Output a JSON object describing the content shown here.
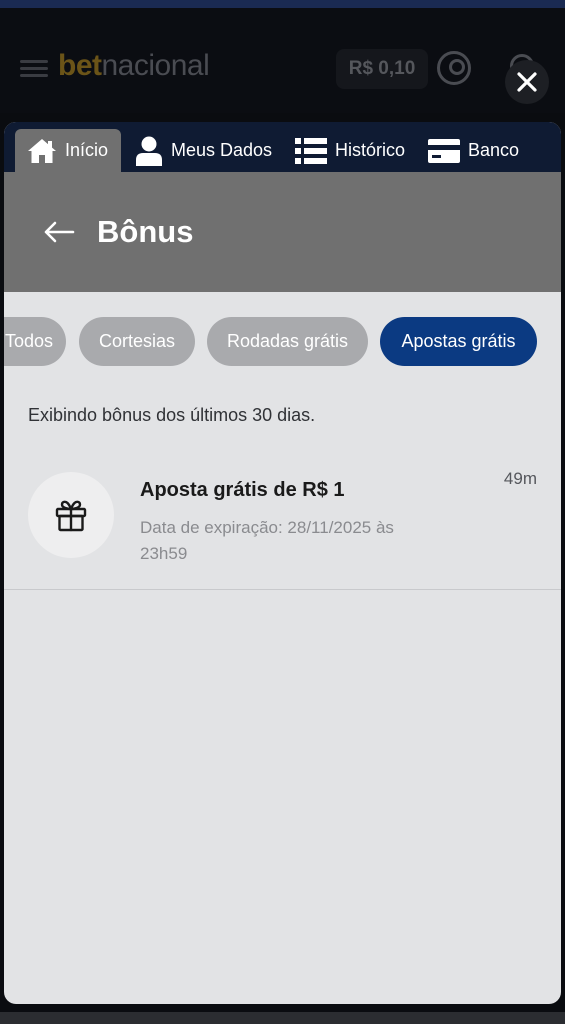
{
  "app": {
    "logo_bet": "bet",
    "logo_nacional": "nacional",
    "balance": "R$ 0,10"
  },
  "tabs": [
    {
      "label": "Início",
      "icon": "home-icon",
      "active": true
    },
    {
      "label": "Meus Dados",
      "icon": "user-icon",
      "active": false
    },
    {
      "label": "Histórico",
      "icon": "list-icon",
      "active": false
    },
    {
      "label": "Banco",
      "icon": "credit-card-icon",
      "active": false
    }
  ],
  "page": {
    "title": "Bônus",
    "back_icon": "arrow-left-icon"
  },
  "filters": [
    {
      "label": "Todos",
      "selected": false
    },
    {
      "label": "Cortesias",
      "selected": false
    },
    {
      "label": "Rodadas grátis",
      "selected": false
    },
    {
      "label": "Apostas grátis",
      "selected": true
    }
  ],
  "info": "Exibindo bônus dos últimos 30 dias.",
  "bonuses": [
    {
      "title": "Aposta grátis de R$ 1",
      "expiry": "Data de expiração: 28/11/2025 às 23h59",
      "time_ago": "49m",
      "icon": "gift-icon"
    }
  ],
  "colors": {
    "accent": "#0b3a82",
    "tab_bar": "#0f1b33",
    "header_band": "#707070",
    "chip_inactive": "#a9aaad",
    "content_bg": "#e2e3e5"
  }
}
